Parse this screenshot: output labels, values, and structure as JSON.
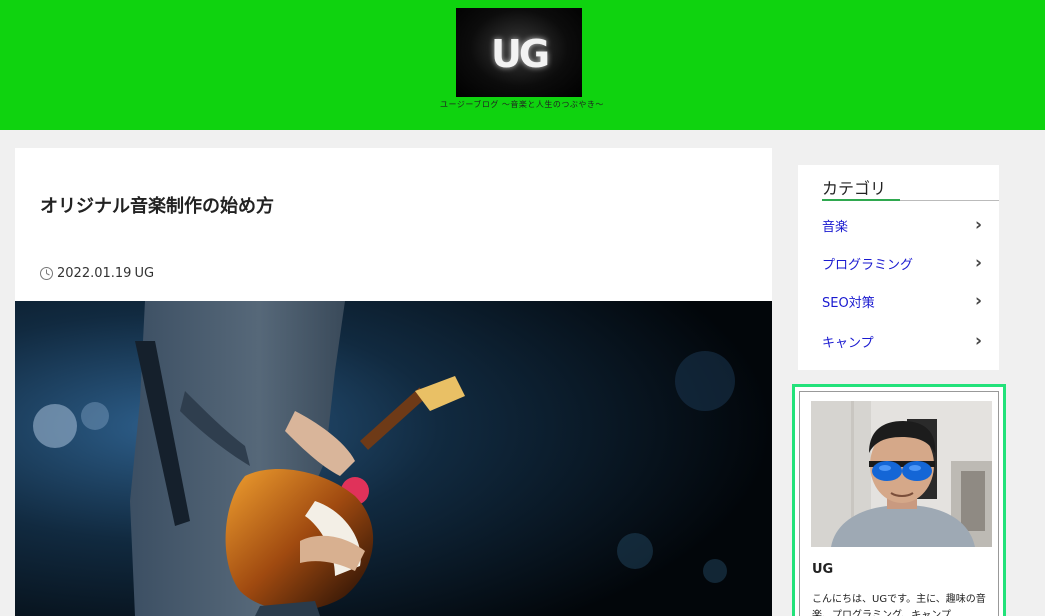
{
  "header": {
    "logo_text": "UG",
    "tagline": "ユージーブログ ～音楽と人生のつぶやき～",
    "background_color": "#0fd30f"
  },
  "article": {
    "title": "オリジナル音楽制作の始め方",
    "date": "2022.01.19",
    "author": "UG",
    "meta_icon": "clock-icon",
    "hero_image": "guitarist-on-stage-photo"
  },
  "sidebar": {
    "categories_heading": "カテゴリ",
    "categories": [
      {
        "label": "音楽"
      },
      {
        "label": "プログラミング"
      },
      {
        "label": "SEO対策"
      },
      {
        "label": "キャンプ"
      }
    ],
    "link_color": "#1a1ad0",
    "accent_color": "#2fa84f"
  },
  "profile": {
    "name": "UG",
    "bio": "こんにちは、UGです。主に、趣味の音楽、プログラミング、キャンプ",
    "border_color": "#22e27a",
    "avatar": "man-with-sunglasses-photo"
  }
}
